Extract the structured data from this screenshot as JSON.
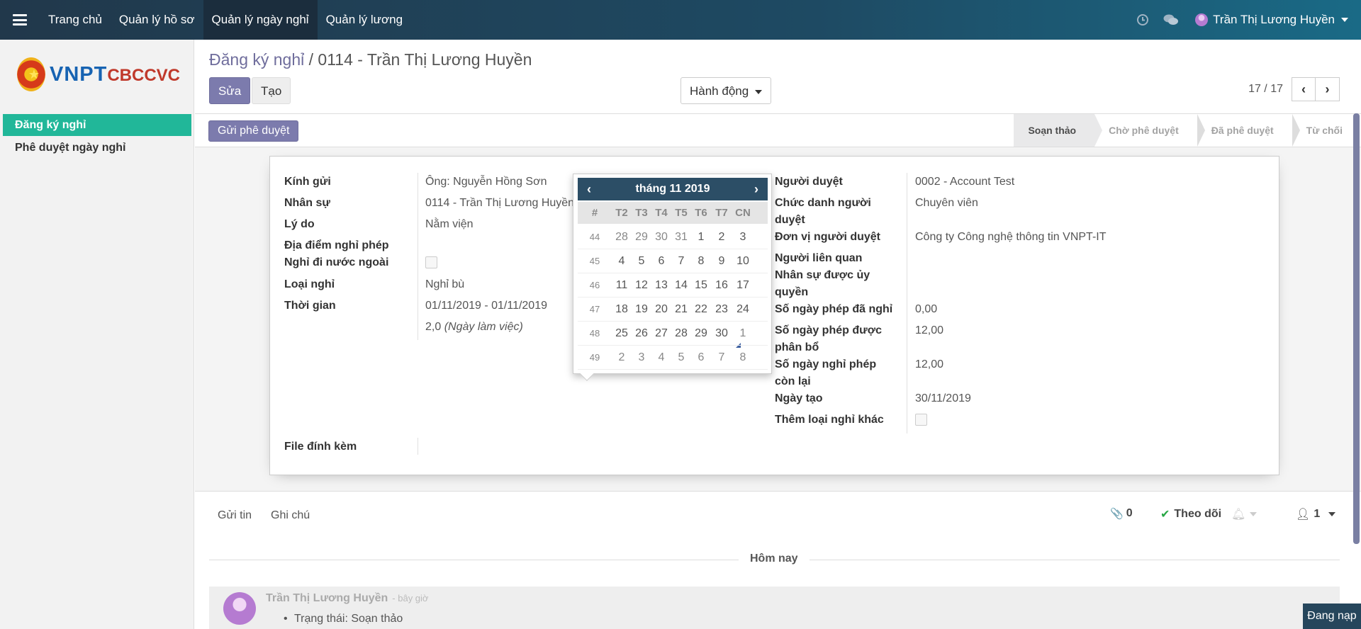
{
  "topbar": {
    "nav": [
      "Trang chủ",
      "Quản lý hồ sơ",
      "Quản lý ngày nghỉ",
      "Quản lý lương"
    ],
    "user_name": "Trần Thị Lương Huyền"
  },
  "sidebar": {
    "logo_a": "VNPT",
    "logo_b": "CBCCVC",
    "items": [
      "Đăng ký nghỉ",
      "Phê duyệt ngày nghỉ"
    ]
  },
  "header": {
    "breadcrumb_parent": "Đăng ký nghỉ",
    "breadcrumb_sep": " / ",
    "breadcrumb_current": "0114 - Trần Thị Lương Huyền",
    "edit_label": "Sửa",
    "create_label": "Tạo",
    "action_label": "Hành động",
    "pager": "17 / 17"
  },
  "statusbar": {
    "send_label": "Gửi phê duyệt",
    "stages": [
      "Soạn thảo",
      "Chờ phê duyệt",
      "Đã phê duyệt",
      "Từ chối"
    ]
  },
  "form_left": {
    "labels": [
      "Kính gửi",
      "Nhân sự",
      "Lý do",
      "Địa điểm nghỉ phép",
      "Nghỉ đi nước ngoài",
      "Loại nghỉ",
      "Thời gian",
      "File đính kèm"
    ],
    "values": {
      "kinh_gui": "Ông: Nguyễn Hồng Sơn",
      "nhan_su": "0114 - Trần Thị Lương Huyền",
      "ly_do": "Nằm viện",
      "loai_nghi": "Nghỉ bù",
      "thoi_gian": "01/11/2019 - 01/11/2019",
      "so_ngay": "2,0",
      "so_ngay_unit": "(Ngày làm việc)"
    }
  },
  "form_right": {
    "labels": {
      "nguoi_duyet": "Người duyệt",
      "chuc_danh_1": "Chức danh người",
      "chuc_danh_2": "duyệt",
      "don_vi": "Đơn vị người duyệt",
      "lien_quan": "Người liên quan",
      "uy_quyen_1": "Nhân sự được ủy",
      "uy_quyen_2": "quyền",
      "da_nghi": "Số ngày phép đã nghỉ",
      "phan_bo_1": "Số ngày phép được",
      "phan_bo_2": "phân bổ",
      "con_lai_1": "Số ngày nghỉ phép",
      "con_lai_2": "còn lại",
      "ngay_tao": "Ngày tạo",
      "them_loai": "Thêm loại nghỉ khác"
    },
    "values": {
      "nguoi_duyet": "0002 - Account Test",
      "chuc_danh": "Chuyên viên",
      "don_vi": "Công ty Công nghệ thông tin VNPT-IT",
      "da_nghi": "0,00",
      "phan_bo": "12,00",
      "con_lai": "12,00",
      "ngay_tao": "30/11/2019"
    }
  },
  "datepicker": {
    "title": "tháng 11 2019",
    "dow": [
      "#",
      "T2",
      "T3",
      "T4",
      "T5",
      "T6",
      "T7",
      "CN"
    ],
    "rows": [
      [
        "44",
        "28",
        "29",
        "30",
        "31",
        "1",
        "2",
        "3"
      ],
      [
        "45",
        "4",
        "5",
        "6",
        "7",
        "8",
        "9",
        "10"
      ],
      [
        "46",
        "11",
        "12",
        "13",
        "14",
        "15",
        "16",
        "17"
      ],
      [
        "47",
        "18",
        "19",
        "20",
        "21",
        "22",
        "23",
        "24"
      ],
      [
        "48",
        "25",
        "26",
        "27",
        "28",
        "29",
        "30",
        "1"
      ],
      [
        "49",
        "2",
        "3",
        "4",
        "5",
        "6",
        "7",
        "8"
      ]
    ]
  },
  "chatter": {
    "send_message": "Gửi tin",
    "log_note": "Ghi chú",
    "attachments": "0",
    "follow": "Theo dõi",
    "followers": "1",
    "day": "Hôm nay",
    "author": "Trần Thị Lương Huyền",
    "time": "- bây giờ",
    "body": "Trạng thái: Soạn thảo"
  },
  "loading": "Đang nạp",
  "colors": {
    "accent": "#7c7bad",
    "sidebar_active": "#21b799",
    "navbar": "#21384b"
  }
}
